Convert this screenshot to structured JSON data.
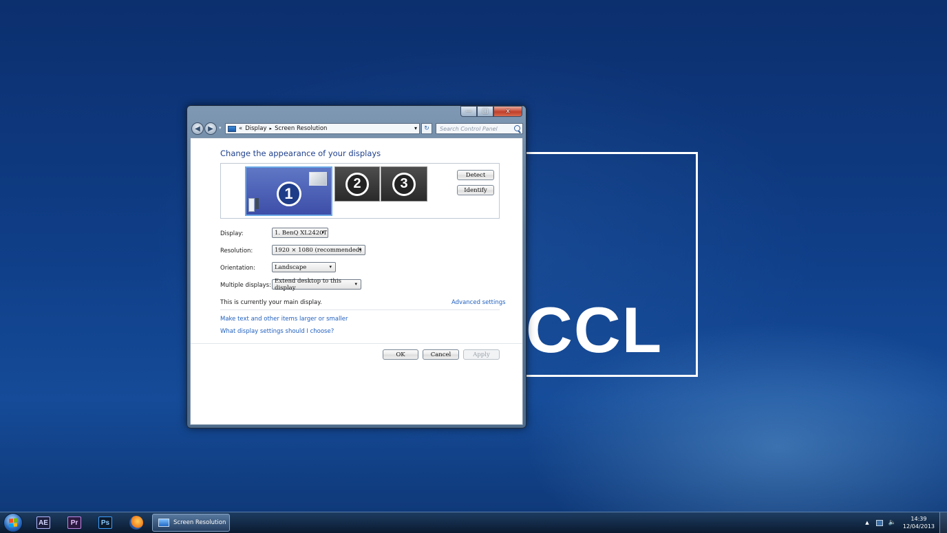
{
  "wallpaper": {
    "logo_text": "CCL"
  },
  "window": {
    "caption_buttons": {
      "minimize": "—",
      "maximize": "□",
      "close": "x"
    },
    "nav": {
      "back_glyph": "◀",
      "forward_glyph": "▶",
      "history_glyph": "▾"
    },
    "address": {
      "prefix": "«",
      "crumb1": "Display",
      "separator": "▸",
      "crumb2": "Screen Resolution",
      "dropdown_glyph": "▾"
    },
    "refresh_glyph": "↻",
    "search": {
      "placeholder": "Search Control Panel"
    },
    "heading": "Change the appearance of your displays",
    "monitors": [
      {
        "number": "1",
        "selected": true
      },
      {
        "number": "2",
        "selected": false
      },
      {
        "number": "3",
        "selected": false
      }
    ],
    "buttons": {
      "detect": "Detect",
      "identify": "Identify",
      "ok": "OK",
      "cancel": "Cancel",
      "apply": "Apply"
    },
    "settings": {
      "display_label": "Display:",
      "display_value": "1. BenQ XL2420T",
      "resolution_label": "Resolution:",
      "resolution_value": "1920 × 1080 (recommended)",
      "orientation_label": "Orientation:",
      "orientation_value": "Landscape",
      "multiple_label": "Multiple displays:",
      "multiple_value": "Extend desktop to this display",
      "dropdown_glyph": "▾"
    },
    "status_text": "This is currently your main display.",
    "links": {
      "advanced": "Advanced settings",
      "text_size": "Make text and other items larger or smaller",
      "help": "What display settings should I choose?"
    }
  },
  "taskbar": {
    "apps": {
      "ae": "AE",
      "pr": "Pr",
      "ps": "Ps"
    },
    "active_task": "Screen Resolution",
    "tray": {
      "up_glyph": "▲",
      "volume_glyph": "🔈",
      "time": "14:39",
      "date": "12/04/2013"
    }
  },
  "colors": {
    "accent": "#1e3f8c",
    "link": "#1f5fbf",
    "desktop": "#0f3d86"
  }
}
